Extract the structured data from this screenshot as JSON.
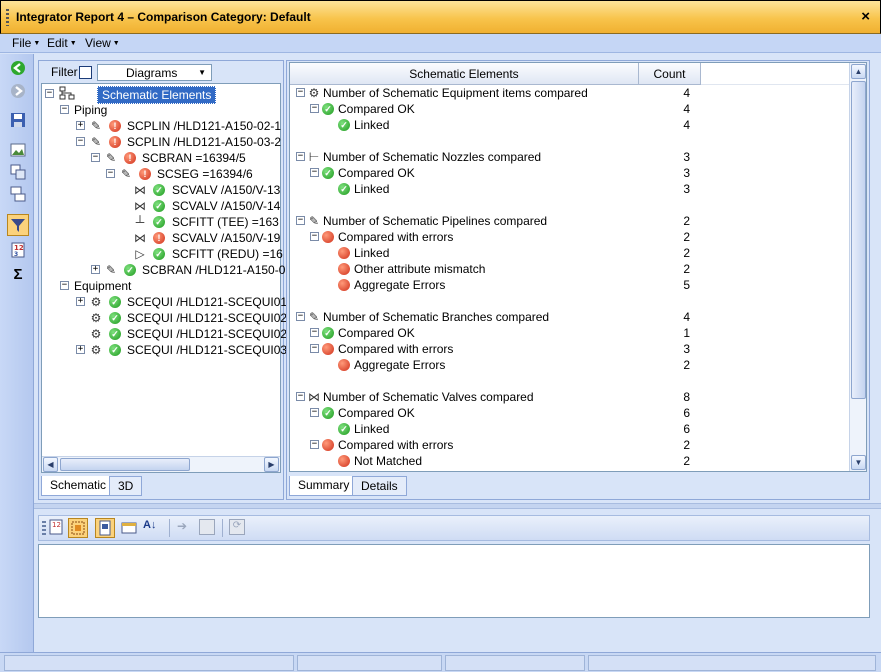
{
  "window": {
    "title": "Integrator Report 4 – Comparison Category: Default",
    "close": "×"
  },
  "menu": [
    {
      "label": "File"
    },
    {
      "label": "Edit"
    },
    {
      "label": "View"
    }
  ],
  "toolstrip": [
    "back-icon",
    "forward-icon",
    "save-icon",
    "image-icon",
    "diagram-icon",
    "layers-icon",
    "filter-icon",
    "sort-icon",
    "sigma-icon"
  ],
  "filter": {
    "label": "Filter",
    "dropdown_value": "Diagrams"
  },
  "tree": {
    "root": "Schematic Elements",
    "piping": "Piping",
    "equipment": "Equipment",
    "rows": [
      {
        "text": "SCPLIN /HLD121-A150-02-1",
        "status": "err"
      },
      {
        "text": "SCPLIN /HLD121-A150-03-2",
        "status": "err"
      },
      {
        "text": "SCBRAN =16394/5",
        "status": "err"
      },
      {
        "text": "SCSEG =16394/6",
        "status": "err"
      },
      {
        "text": "SCVALV /A150/V-13",
        "status": "ok"
      },
      {
        "text": "SCVALV /A150/V-14",
        "status": "ok"
      },
      {
        "text": "SCFITT (TEE) =163",
        "status": "ok"
      },
      {
        "text": "SCVALV /A150/V-19",
        "status": "err"
      },
      {
        "text": "SCFITT (REDU) =16",
        "status": "ok"
      },
      {
        "text": "SCBRAN /HLD121-A150-0",
        "status": "ok"
      },
      {
        "text": "SCEQUI /HLD121-SCEQUI01",
        "status": "ok"
      },
      {
        "text": "SCEQUI /HLD121-SCEQUI02",
        "status": "ok"
      },
      {
        "text": "SCEQUI /HLD121-SCEQUI02",
        "status": "ok"
      },
      {
        "text": "SCEQUI /HLD121-SCEQUI03",
        "status": "ok"
      }
    ]
  },
  "left_tabs": [
    "Schematic",
    "3D"
  ],
  "summary": {
    "columns": [
      "Schematic Elements",
      "Count"
    ],
    "rows": [
      {
        "text": "Number of Schematic Equipment items compared",
        "count": "4",
        "icon": "equipment-icon",
        "status": ""
      },
      {
        "text": "Compared OK",
        "count": "4",
        "status": "ok"
      },
      {
        "text": "Linked",
        "count": "4",
        "status": "ok"
      },
      {
        "text": "Number of Schematic Nozzles compared",
        "count": "3",
        "icon": "nozzle-icon",
        "status": ""
      },
      {
        "text": "Compared OK",
        "count": "3",
        "status": "ok"
      },
      {
        "text": "Linked",
        "count": "3",
        "status": "ok"
      },
      {
        "text": "Number of Schematic Pipelines compared",
        "count": "2",
        "icon": "pipeline-icon",
        "status": ""
      },
      {
        "text": "Compared with errors",
        "count": "2",
        "status": "err"
      },
      {
        "text": "Linked",
        "count": "2",
        "status": "err"
      },
      {
        "text": "Other attribute mismatch",
        "count": "2",
        "status": "err"
      },
      {
        "text": "Aggregate Errors",
        "count": "5",
        "status": "err"
      },
      {
        "text": "Number of Schematic Branches compared",
        "count": "4",
        "icon": "branch-icon",
        "status": ""
      },
      {
        "text": "Compared OK",
        "count": "1",
        "status": "ok"
      },
      {
        "text": "Compared with errors",
        "count": "3",
        "status": "err"
      },
      {
        "text": "Aggregate Errors",
        "count": "2",
        "status": "err"
      },
      {
        "text": "Number of Schematic Valves compared",
        "count": "8",
        "icon": "valve-icon",
        "status": ""
      },
      {
        "text": "Compared OK",
        "count": "6",
        "status": "ok"
      },
      {
        "text": "Linked",
        "count": "6",
        "status": "ok"
      },
      {
        "text": "Compared with errors",
        "count": "2",
        "status": "err"
      },
      {
        "text": "Not Matched",
        "count": "2",
        "status": "err"
      }
    ]
  },
  "right_tabs": [
    "Summary",
    "Details"
  ],
  "colors": {
    "titlebar": "#f8c44c",
    "ok": "#1f9a1f",
    "error": "#d0301a",
    "selection": "#316ac5"
  }
}
